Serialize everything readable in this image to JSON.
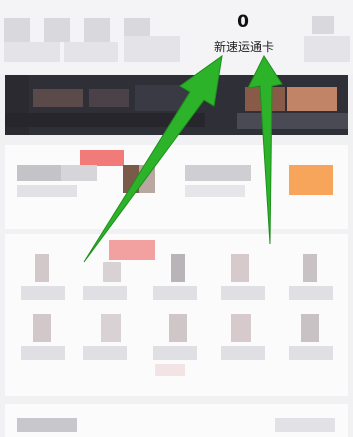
{
  "pass_card": {
    "count": "0",
    "label": "新速运通卡"
  },
  "colors": {
    "arrow": "#2db32a",
    "banner": "#2f2f38",
    "accent_red": "#f07b79",
    "accent_orange": "#f6a55a"
  },
  "icons": [
    "pixelated-menu-icon",
    "green-arrow-annotation"
  ]
}
